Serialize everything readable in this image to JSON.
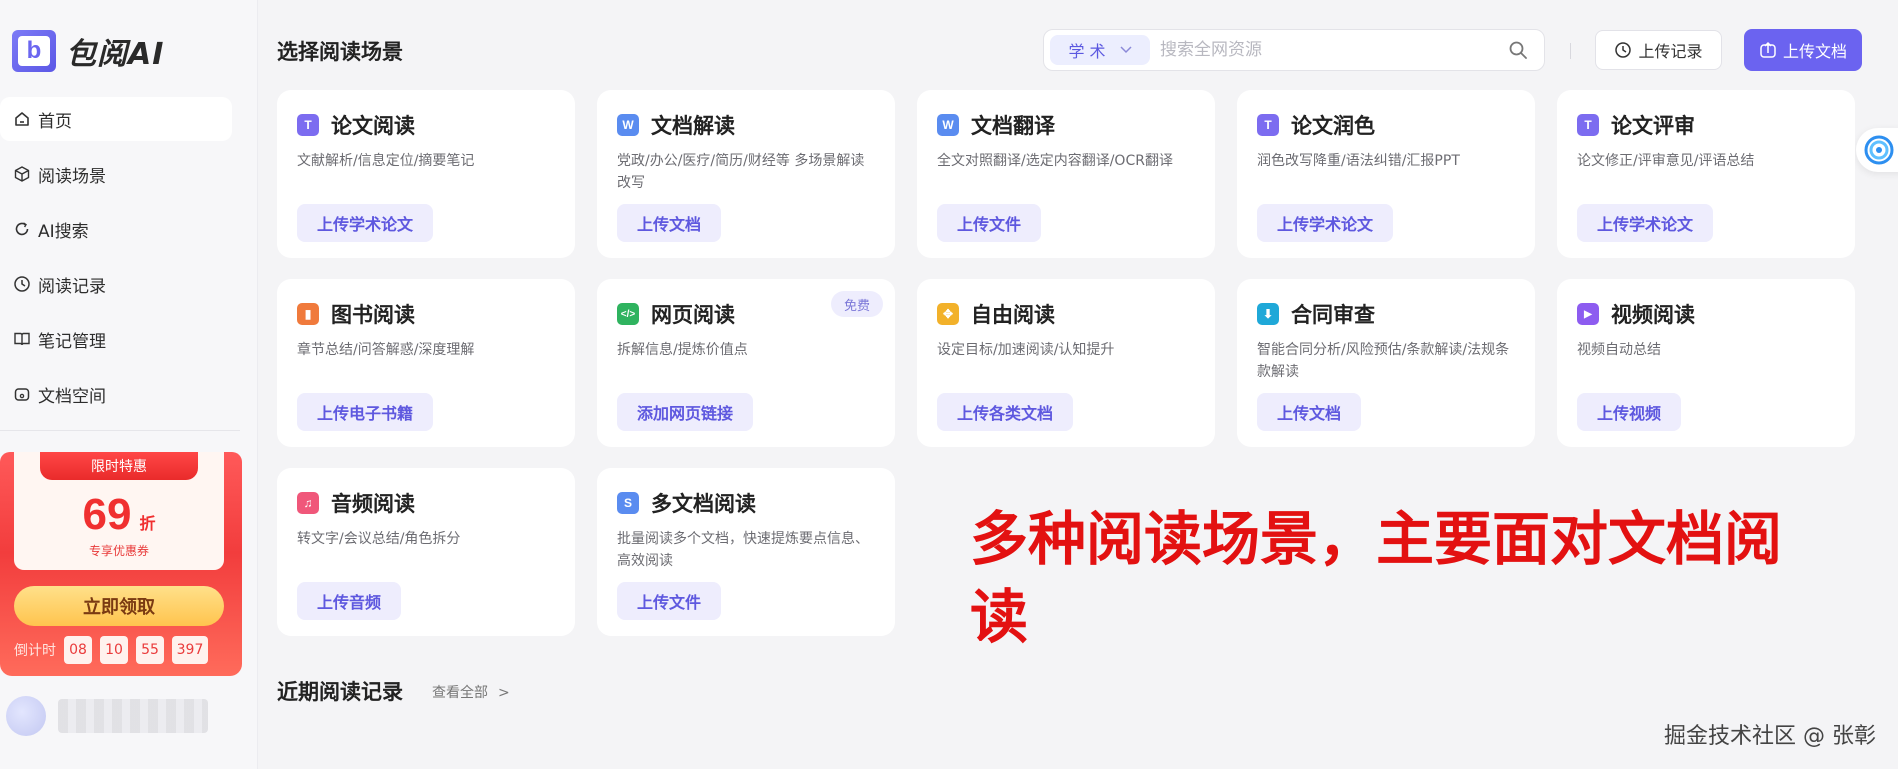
{
  "app": {
    "logo_letter": "b",
    "name": "包阅AI"
  },
  "sidebar": {
    "items": [
      {
        "label": "首页",
        "icon": "home-icon",
        "active": true
      },
      {
        "label": "阅读场景",
        "icon": "cube-icon",
        "active": false
      },
      {
        "label": "AI搜索",
        "icon": "refresh-search-icon",
        "active": false
      },
      {
        "label": "阅读记录",
        "icon": "clock-icon",
        "active": false
      },
      {
        "label": "笔记管理",
        "icon": "book-icon",
        "active": false
      },
      {
        "label": "文档空间",
        "icon": "folder-icon",
        "active": false
      }
    ],
    "promo": {
      "ribbon": "限时特惠",
      "value": "69",
      "unit": "折",
      "subtitle": "专享优惠券",
      "button": "立即领取",
      "countdown_label": "倒计时",
      "countdown": [
        "08",
        "10",
        "55",
        "397"
      ]
    }
  },
  "header": {
    "title": "选择阅读场景",
    "search": {
      "scope": "学 术",
      "placeholder": "搜索全网资源",
      "value": ""
    },
    "history_button": "上传记录",
    "upload_button": "上传文档"
  },
  "cards": [
    {
      "title": "论文阅读",
      "badge": "T",
      "badge_color": "#7c6cf0",
      "desc": "文献解析/信息定位/摘要笔记",
      "button": "上传学术论文"
    },
    {
      "title": "文档解读",
      "badge": "W",
      "badge_color": "#5a8cf0",
      "desc": "党政/办公/医疗/简历/财经等 多场景解读改写",
      "button": "上传文档"
    },
    {
      "title": "文档翻译",
      "badge": "W",
      "badge_color": "#5a8cf0",
      "desc": "全文对照翻译/选定内容翻译/OCR翻译",
      "button": "上传文件"
    },
    {
      "title": "论文润色",
      "badge": "T",
      "badge_color": "#7c6cf0",
      "desc": "润色改写降重/语法纠错/汇报PPT",
      "button": "上传学术论文"
    },
    {
      "title": "论文评审",
      "badge": "T",
      "badge_color": "#7c6cf0",
      "desc": "论文修正/评审意见/评语总结",
      "button": "上传学术论文"
    },
    {
      "title": "图书阅读",
      "badge": "▮",
      "badge_color": "#f07a3c",
      "desc": "章节总结/问答解惑/深度理解",
      "button": "上传电子书籍"
    },
    {
      "title": "网页阅读",
      "badge": "</>",
      "badge_color": "#2fb35f",
      "desc": "拆解信息/提炼价值点",
      "button": "添加网页链接",
      "tag": "免费"
    },
    {
      "title": "自由阅读",
      "badge": "✥",
      "badge_color": "#f2b12a",
      "desc": "设定目标/加速阅读/认知提升",
      "button": "上传各类文档"
    },
    {
      "title": "合同审查",
      "badge": "⬇",
      "badge_color": "#1fa8d8",
      "desc": "智能合同分析/风险预估/条款解读/法规条款解读",
      "button": "上传文档"
    },
    {
      "title": "视频阅读",
      "badge": "▶",
      "badge_color": "#8d5cf0",
      "desc": "视频自动总结",
      "button": "上传视频"
    },
    {
      "title": "音频阅读",
      "badge": "♫",
      "badge_color": "#f0577a",
      "desc": "转文字/会议总结/角色拆分",
      "button": "上传音频"
    },
    {
      "title": "多文档阅读",
      "badge": "S",
      "badge_color": "#5a8cf0",
      "desc": "批量阅读多个文档，快速提炼要点信息、高效阅读",
      "button": "上传文件"
    }
  ],
  "annotation": "多种阅读场景，主要面对文档阅读",
  "recent": {
    "title": "近期阅读记录",
    "view_all": "查看全部",
    "arrow": ">"
  },
  "watermark": "掘金技术社区 @ 张彰"
}
